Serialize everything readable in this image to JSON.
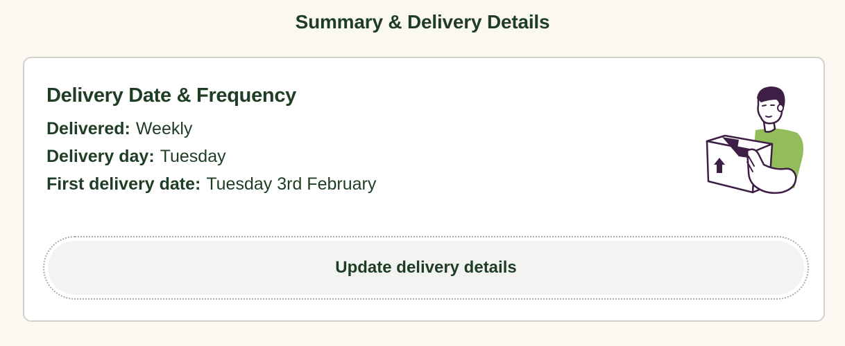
{
  "page": {
    "title": "Summary & Delivery Details"
  },
  "delivery": {
    "heading": "Delivery Date & Frequency",
    "rows": [
      {
        "label": "Delivered:",
        "value": "Weekly"
      },
      {
        "label": "Delivery day:",
        "value": "Tuesday"
      },
      {
        "label": "First delivery date:",
        "value": "Tuesday 3rd February"
      }
    ],
    "illustration_icon": "delivery-person-holding-box-icon",
    "update_button_label": "Update delivery details"
  },
  "colors": {
    "background": "#fbf8f1",
    "text": "#1f3d24",
    "card_border": "#d4d1cc",
    "button_bg": "#f3f3f2",
    "illustration_green": "#93bd5a",
    "illustration_outline": "#3d1f45"
  }
}
